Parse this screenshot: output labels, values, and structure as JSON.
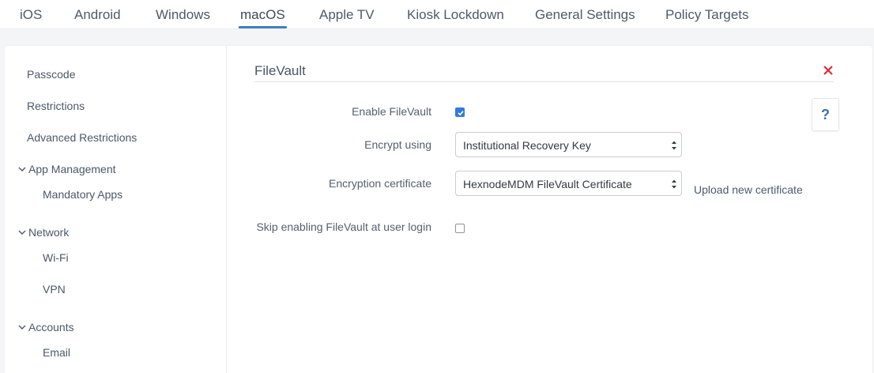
{
  "tabs": [
    {
      "label": "iOS"
    },
    {
      "label": "Android"
    },
    {
      "label": "Windows"
    },
    {
      "label": "macOS",
      "active": true
    },
    {
      "label": "Apple TV"
    },
    {
      "label": "Kiosk Lockdown"
    },
    {
      "label": "General Settings"
    },
    {
      "label": "Policy Targets"
    }
  ],
  "sidebar": {
    "passcode": "Passcode",
    "restrictions": "Restrictions",
    "advanced_restrictions": "Advanced Restrictions",
    "app_management": {
      "label": "App Management",
      "children": [
        "Mandatory Apps"
      ]
    },
    "network": {
      "label": "Network",
      "children": [
        "Wi-Fi",
        "VPN"
      ]
    },
    "accounts": {
      "label": "Accounts",
      "children": [
        "Email"
      ]
    }
  },
  "filevault": {
    "title": "FileVault",
    "help_label": "?",
    "enable": {
      "label": "Enable FileVault",
      "checked": true
    },
    "encrypt_using": {
      "label": "Encrypt using",
      "value": "Institutional Recovery Key"
    },
    "certificate": {
      "label": "Encryption certificate",
      "value": "HexnodeMDM FileVault Certificate",
      "upload_link": "Upload new certificate"
    },
    "skip_login": {
      "label": "Skip enabling FileVault at user login",
      "checked": false
    }
  },
  "colors": {
    "accent": "#3f7fc4",
    "checkbox_checked": "#2f7ae5",
    "close_red": "#e0242b",
    "help_blue": "#3a6fb0"
  },
  "icons": [
    "close-icon",
    "help-icon",
    "chevron-down-icon",
    "select-arrows-icon",
    "checkmark-icon"
  ]
}
